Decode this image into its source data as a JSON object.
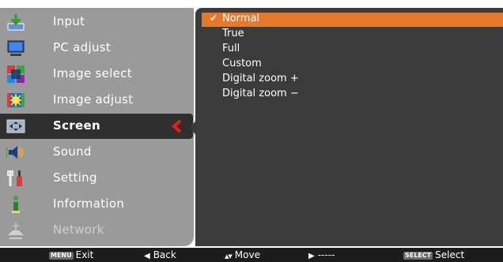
{
  "menu": {
    "items": [
      {
        "label": "Input",
        "icon": "input-icon"
      },
      {
        "label": "PC adjust",
        "icon": "monitor-icon"
      },
      {
        "label": "Image select",
        "icon": "image-select-icon"
      },
      {
        "label": "Image adjust",
        "icon": "image-adjust-icon"
      },
      {
        "label": "Screen",
        "icon": "screen-icon",
        "selected": true
      },
      {
        "label": "Sound",
        "icon": "speaker-icon"
      },
      {
        "label": "Setting",
        "icon": "tools-icon"
      },
      {
        "label": "Information",
        "icon": "info-icon"
      },
      {
        "label": "Network",
        "icon": "network-icon",
        "dimmed": true
      }
    ]
  },
  "submenu": {
    "items": [
      {
        "label": "Normal",
        "selected": true,
        "checked": true
      },
      {
        "label": "True"
      },
      {
        "label": "Full"
      },
      {
        "label": "Custom"
      },
      {
        "label": "Digital zoom +"
      },
      {
        "label": "Digital zoom −"
      }
    ],
    "check_glyph": "✔"
  },
  "bottom_bar": {
    "exit": {
      "key": "MENU",
      "label": "Exit"
    },
    "back": {
      "glyph": "◀",
      "label": "Back"
    },
    "move": {
      "glyph": "▲▼",
      "label": "Move"
    },
    "next": {
      "glyph": "▶",
      "label": "-----"
    },
    "select": {
      "key": "SELECT",
      "label": "Select"
    }
  },
  "colors": {
    "menu_bg": "#9a9a9a",
    "submenu_bg": "#3b3b3b",
    "highlight": "#e8782a",
    "selection_arrow": "#e0201e",
    "bottom_bar": "#1c1c1c"
  }
}
